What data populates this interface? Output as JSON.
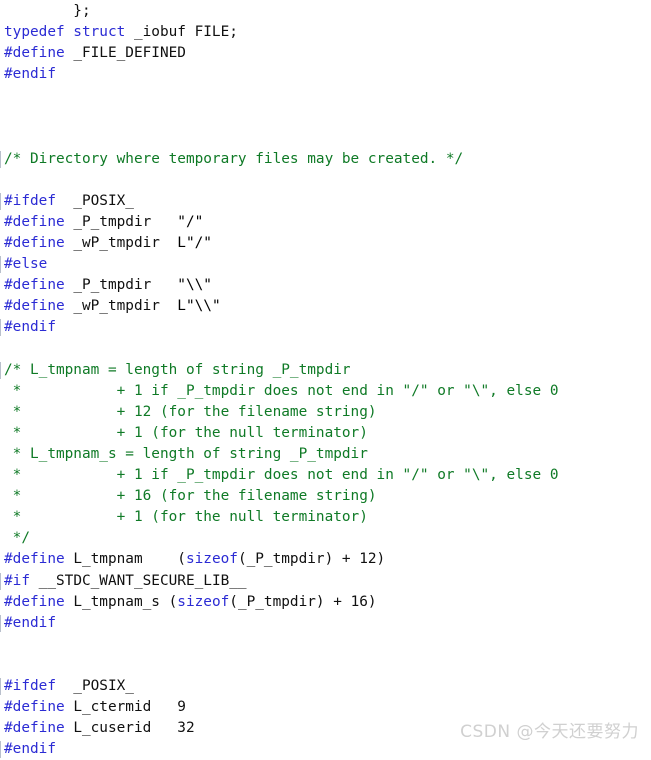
{
  "editor": {
    "background_color": "#ffffff",
    "font_size_px": 14.4,
    "line_height_px": 21.1,
    "colors": {
      "preprocessor": "#2b2bd4",
      "keyword": "#2b2bd4",
      "identifier": "#101010",
      "comment": "#0f7a26",
      "string": "#9b2d30",
      "fold_marker": "#b9c0cc",
      "watermark": "#d0d0d0"
    }
  },
  "watermark": {
    "text": "CSDN @今天还要努力"
  },
  "code": {
    "language": "c",
    "lines": [
      {
        "folded": false,
        "tokens": [
          {
            "class": "plain",
            "text": "        };"
          }
        ]
      },
      {
        "folded": false,
        "tokens": [
          {
            "class": "kw",
            "text": "typedef struct"
          },
          {
            "class": "plain",
            "text": " _iobuf FILE;"
          }
        ]
      },
      {
        "folded": false,
        "tokens": [
          {
            "class": "pp",
            "text": "#define"
          },
          {
            "class": "plain",
            "text": " _FILE_DEFINED"
          }
        ]
      },
      {
        "folded": false,
        "tokens": [
          {
            "class": "pp",
            "text": "#endif"
          }
        ]
      },
      {
        "folded": false,
        "tokens": []
      },
      {
        "folded": false,
        "tokens": []
      },
      {
        "folded": false,
        "tokens": []
      },
      {
        "folded": true,
        "tokens": [
          {
            "class": "comment",
            "text": "/* Directory where temporary files may be created. */"
          }
        ]
      },
      {
        "folded": false,
        "tokens": []
      },
      {
        "folded": true,
        "tokens": [
          {
            "class": "pp",
            "text": "#ifdef"
          },
          {
            "class": "plain",
            "text": "  _POSIX_"
          }
        ]
      },
      {
        "folded": false,
        "tokens": [
          {
            "class": "pp",
            "text": "#define"
          },
          {
            "class": "plain",
            "text": " _P_tmpdir   "
          },
          {
            "class": "str",
            "text": "\"/\""
          }
        ]
      },
      {
        "folded": false,
        "tokens": [
          {
            "class": "pp",
            "text": "#define"
          },
          {
            "class": "plain",
            "text": " _wP_tmpdir  "
          },
          {
            "class": "str",
            "text": "L\"/\""
          }
        ]
      },
      {
        "folded": true,
        "tokens": [
          {
            "class": "pp",
            "text": "#else"
          }
        ]
      },
      {
        "folded": false,
        "tokens": [
          {
            "class": "pp",
            "text": "#define"
          },
          {
            "class": "plain",
            "text": " _P_tmpdir   "
          },
          {
            "class": "str",
            "text": "\"\\\\\""
          }
        ]
      },
      {
        "folded": false,
        "tokens": [
          {
            "class": "pp",
            "text": "#define"
          },
          {
            "class": "plain",
            "text": " _wP_tmpdir  "
          },
          {
            "class": "str",
            "text": "L\"\\\\\""
          }
        ]
      },
      {
        "folded": true,
        "tokens": [
          {
            "class": "pp",
            "text": "#endif"
          }
        ]
      },
      {
        "folded": false,
        "tokens": []
      },
      {
        "folded": true,
        "tokens": [
          {
            "class": "comment",
            "text": "/* L_tmpnam = length of string _P_tmpdir"
          }
        ]
      },
      {
        "folded": false,
        "tokens": [
          {
            "class": "comment",
            "text": " *           + 1 if _P_tmpdir does not end in \"/\" or \"\\\", else 0"
          }
        ]
      },
      {
        "folded": false,
        "tokens": [
          {
            "class": "comment",
            "text": " *           + 12 (for the filename string)"
          }
        ]
      },
      {
        "folded": false,
        "tokens": [
          {
            "class": "comment",
            "text": " *           + 1 (for the null terminator)"
          }
        ]
      },
      {
        "folded": false,
        "tokens": [
          {
            "class": "comment",
            "text": " * L_tmpnam_s = length of string _P_tmpdir"
          }
        ]
      },
      {
        "folded": false,
        "tokens": [
          {
            "class": "comment",
            "text": " *           + 1 if _P_tmpdir does not end in \"/\" or \"\\\", else 0"
          }
        ]
      },
      {
        "folded": false,
        "tokens": [
          {
            "class": "comment",
            "text": " *           + 16 (for the filename string)"
          }
        ]
      },
      {
        "folded": false,
        "tokens": [
          {
            "class": "comment",
            "text": " *           + 1 (for the null terminator)"
          }
        ]
      },
      {
        "folded": false,
        "tokens": [
          {
            "class": "comment",
            "text": " */"
          }
        ]
      },
      {
        "folded": false,
        "tokens": [
          {
            "class": "pp",
            "text": "#define"
          },
          {
            "class": "plain",
            "text": " L_tmpnam    ("
          },
          {
            "class": "kw",
            "text": "sizeof"
          },
          {
            "class": "plain",
            "text": "(_P_tmpdir) + 12)"
          }
        ]
      },
      {
        "folded": true,
        "tokens": [
          {
            "class": "pp",
            "text": "#if"
          },
          {
            "class": "plain",
            "text": " __STDC_WANT_SECURE_LIB__"
          }
        ]
      },
      {
        "folded": false,
        "tokens": [
          {
            "class": "pp",
            "text": "#define"
          },
          {
            "class": "plain",
            "text": " L_tmpnam_s ("
          },
          {
            "class": "kw",
            "text": "sizeof"
          },
          {
            "class": "plain",
            "text": "(_P_tmpdir) + 16)"
          }
        ]
      },
      {
        "folded": true,
        "tokens": [
          {
            "class": "pp",
            "text": "#endif"
          }
        ]
      },
      {
        "folded": false,
        "tokens": []
      },
      {
        "folded": false,
        "tokens": []
      },
      {
        "folded": true,
        "tokens": [
          {
            "class": "pp",
            "text": "#ifdef"
          },
          {
            "class": "plain",
            "text": "  _POSIX_"
          }
        ]
      },
      {
        "folded": false,
        "tokens": [
          {
            "class": "pp",
            "text": "#define"
          },
          {
            "class": "plain",
            "text": " L_ctermid   9"
          }
        ]
      },
      {
        "folded": false,
        "tokens": [
          {
            "class": "pp",
            "text": "#define"
          },
          {
            "class": "plain",
            "text": " L_cuserid   32"
          }
        ]
      },
      {
        "folded": true,
        "tokens": [
          {
            "class": "pp",
            "text": "#endif"
          }
        ]
      }
    ]
  }
}
